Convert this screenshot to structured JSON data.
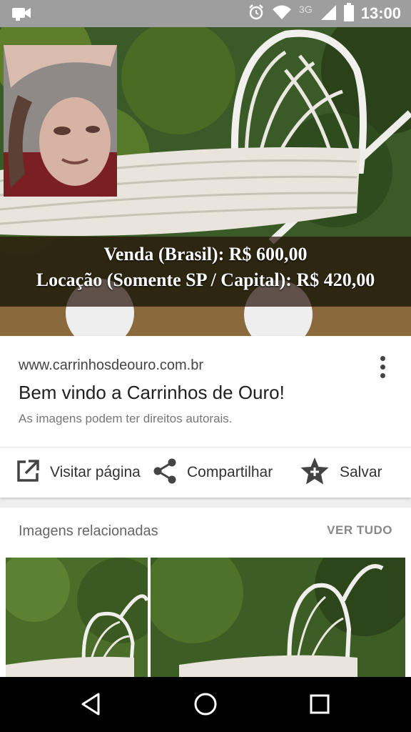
{
  "status_bar": {
    "network": "3G",
    "time": "13:00",
    "icons": [
      "video-notification-icon",
      "alarm-icon",
      "wifi-icon",
      "signal-icon",
      "battery-icon"
    ]
  },
  "hero": {
    "price_line_1": "Venda (Brasil): R$ 600,00",
    "price_line_2": "Locação (Somente SP / Capital): R$ 420,00"
  },
  "result": {
    "url": "www.carrinhosdeouro.com.br",
    "title": "Bem vindo a Carrinhos de Ouro!",
    "copyright_notice": "As imagens podem ter direitos autorais."
  },
  "actions": {
    "visit": "Visitar página",
    "share": "Compartilhar",
    "save": "Salvar"
  },
  "related": {
    "title": "Imagens relacionadas",
    "see_all": "VER TUDO"
  },
  "nav": {
    "icons": [
      "back-icon",
      "home-icon",
      "recents-icon"
    ]
  }
}
